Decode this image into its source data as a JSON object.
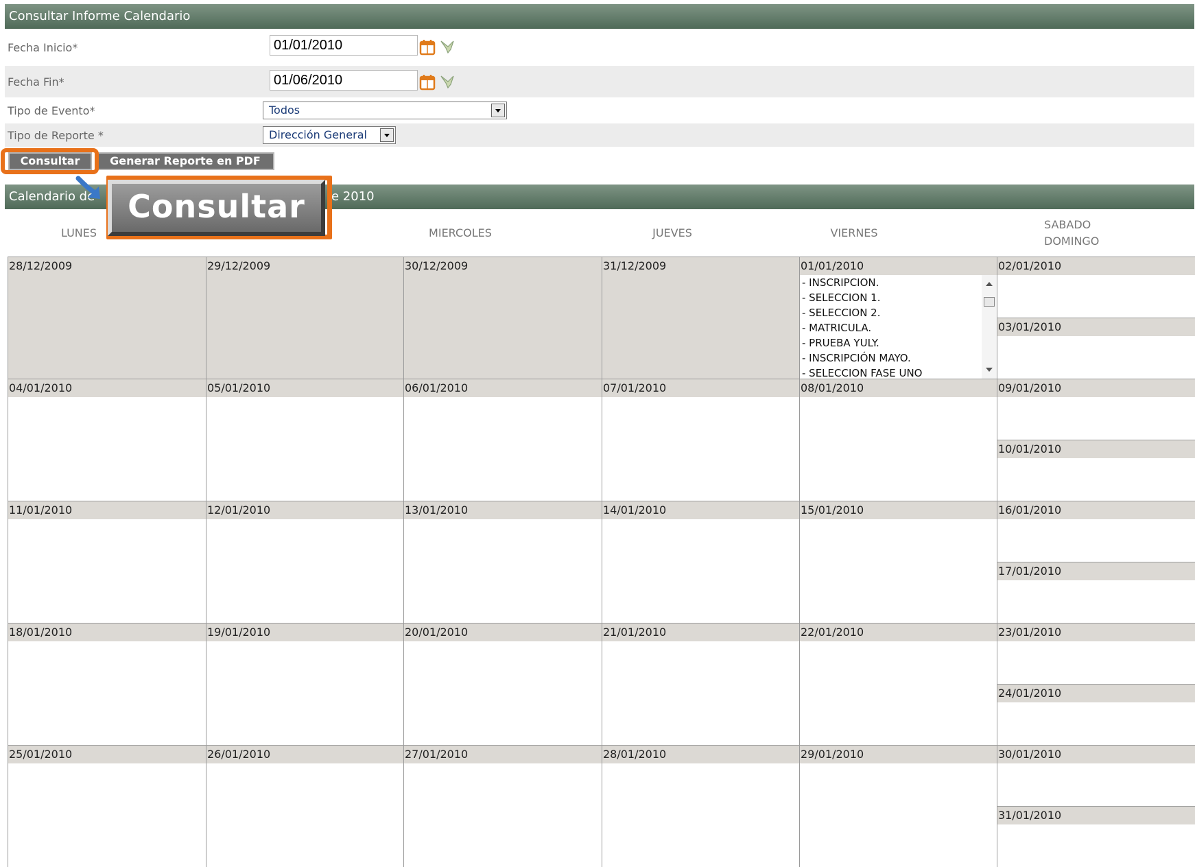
{
  "form": {
    "title": "Consultar Informe Calendario",
    "fecha_inicio_label": "Fecha Inicio*",
    "fecha_inicio_value": "01/01/2010",
    "fecha_fin_label": "Fecha Fin*",
    "fecha_fin_value": "01/06/2010",
    "tipo_evento_label": "Tipo de Evento*",
    "tipo_evento_value": "Todos",
    "tipo_reporte_label": "Tipo de Reporte *",
    "tipo_reporte_value": "Dirección General",
    "consultar_label": "Consultar",
    "pdf_label": "Generar Reporte en PDF"
  },
  "callout": {
    "zoom_label": "Consultar",
    "accent_color": "#e8711a",
    "arrow_color": "#3a78c8"
  },
  "calendar": {
    "title_left": "Calendario de",
    "title_right": "e 2010",
    "weekdays": [
      "LUNES",
      "MIERCOLES",
      "JUEVES",
      "VIERNES",
      "SABADO",
      "DOMINGO"
    ],
    "weeks": [
      [
        "28/12/2009",
        "29/12/2009",
        "30/12/2009",
        "31/12/2009",
        "01/01/2010",
        "02/01/2010",
        "03/01/2010"
      ],
      [
        "04/01/2010",
        "05/01/2010",
        "06/01/2010",
        "07/01/2010",
        "08/01/2010",
        "09/01/2010",
        "10/01/2010"
      ],
      [
        "11/01/2010",
        "12/01/2010",
        "13/01/2010",
        "14/01/2010",
        "15/01/2010",
        "16/01/2010",
        "17/01/2010"
      ],
      [
        "18/01/2010",
        "19/01/2010",
        "20/01/2010",
        "21/01/2010",
        "22/01/2010",
        "23/01/2010",
        "24/01/2010"
      ],
      [
        "25/01/2010",
        "26/01/2010",
        "27/01/2010",
        "28/01/2010",
        "29/01/2010",
        "30/01/2010",
        "31/01/2010"
      ]
    ],
    "events_0101": [
      "- INSCRIPCION.",
      "- SELECCION 1.",
      "- SELECCION 2.",
      "- MATRICULA.",
      "- PRUEBA YULY.",
      "- INSCRIPCIÓN MAYO.",
      "- SELECCION FASE UNO"
    ]
  }
}
